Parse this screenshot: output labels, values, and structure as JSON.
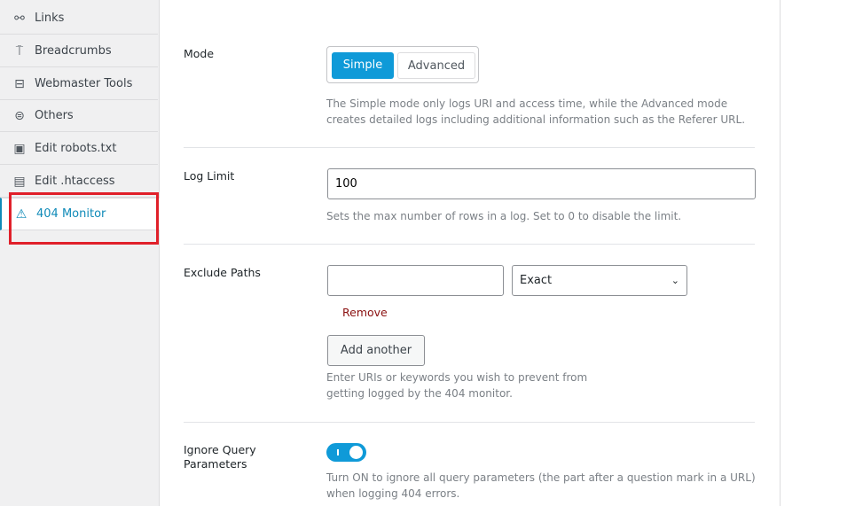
{
  "sidebar": {
    "items": [
      {
        "label": "Links",
        "icon": "link-icon"
      },
      {
        "label": "Breadcrumbs",
        "icon": "signpost-icon"
      },
      {
        "label": "Webmaster Tools",
        "icon": "toolbox-icon"
      },
      {
        "label": "Others",
        "icon": "list-circle-icon"
      },
      {
        "label": "Edit robots.txt",
        "icon": "robots-file-icon"
      },
      {
        "label": "Edit .htaccess",
        "icon": "file-icon"
      },
      {
        "label": "404 Monitor",
        "icon": "warning-icon",
        "active": true
      }
    ]
  },
  "highlight_color": "#e0202a",
  "mode": {
    "label": "Mode",
    "options": [
      "Simple",
      "Advanced"
    ],
    "selected": "Simple",
    "help": "The Simple mode only logs URI and access time, while the Advanced mode creates detailed logs including additional information such as the Referer URL."
  },
  "log_limit": {
    "label": "Log Limit",
    "value": "100",
    "help": "Sets the max number of rows in a log. Set to 0 to disable the limit."
  },
  "exclude": {
    "label": "Exclude Paths",
    "value": "",
    "match": "Exact",
    "remove": "Remove",
    "add": "Add another",
    "help": "Enter URIs or keywords you wish to prevent from getting logged by the 404 monitor."
  },
  "ignore_query": {
    "label": "Ignore Query Parameters",
    "enabled": true,
    "help": "Turn ON to ignore all query parameters (the part after a question mark in a URL) when logging 404 errors."
  },
  "accent": "#0f9ad8"
}
